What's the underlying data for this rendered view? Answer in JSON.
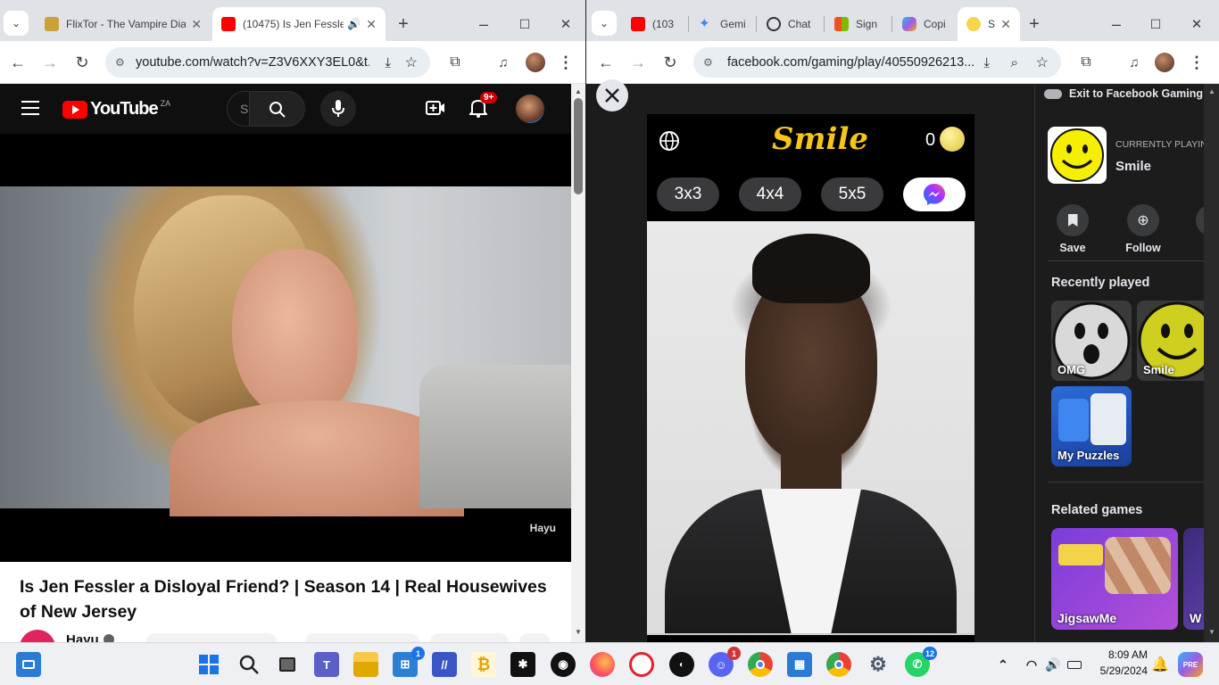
{
  "left_window": {
    "tabs": [
      {
        "title": "FlixTor - The Vampire Dia",
        "active": false
      },
      {
        "title": "(10475) Is Jen Fessle",
        "active": true
      }
    ],
    "url": "youtube.com/watch?v=Z3V6XXY3EL0&t...",
    "youtube": {
      "logo_text": "YouTube",
      "region": "ZA",
      "search_placeholder": "S",
      "notification_count": "9+",
      "watermark": "Hayu",
      "video_title": "Is Jen Fessler a Disloyal Friend? | Season 14 | Real Housewives of New Jersey",
      "channel_name": "Hayu"
    }
  },
  "right_window": {
    "tabs": [
      {
        "title": "(103",
        "active": false
      },
      {
        "title": "Gemi",
        "active": false
      },
      {
        "title": "Chat",
        "active": false
      },
      {
        "title": "Sign",
        "active": false
      },
      {
        "title": "Copi",
        "active": false
      },
      {
        "title": "S",
        "active": true
      }
    ],
    "url": "facebook.com/gaming/play/40550926213...",
    "game": {
      "title": "Smile",
      "coins": "0",
      "grid_options": [
        "3x3",
        "4x4",
        "5x5"
      ]
    },
    "sidebar": {
      "exit_label": "Exit to Facebook Gaming",
      "currently_playing_label": "CURRENTLY PLAYING",
      "current_game": "Smile",
      "actions": [
        "Save",
        "Follow"
      ],
      "recently_played_heading": "Recently played",
      "recently_played": [
        "OMG",
        "Smile",
        "My Puzzles"
      ],
      "related_heading": "Related games",
      "related": [
        "JigsawMe",
        "W"
      ]
    }
  },
  "taskbar": {
    "time": "8:09 AM",
    "date": "5/29/2024",
    "badges": {
      "store": "1",
      "discord": "1",
      "whatsapp": "12"
    }
  },
  "colors": {
    "youtube_red": "#ff0000",
    "game_title_yellow": "#f5c518",
    "accent_blue": "#1a73e8"
  }
}
